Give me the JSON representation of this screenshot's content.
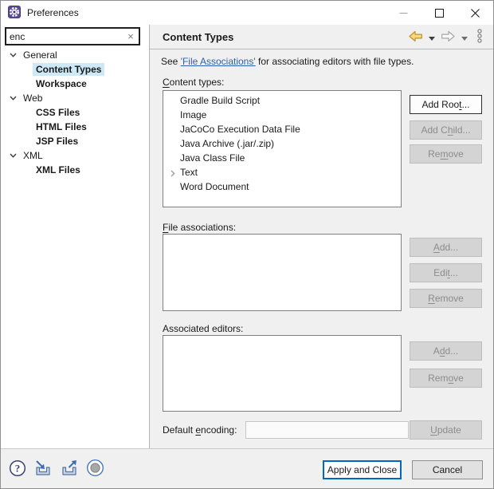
{
  "window": {
    "title": "Preferences"
  },
  "icons": {
    "app": "purple-gear",
    "minimize": "dash",
    "maximize": "square",
    "close": "x",
    "search_clear": "×",
    "tree_expanded": "chevron-down",
    "item_collapsed": "chevron-right",
    "nav_back": "yellow-back-arrow",
    "nav_back_menu": "caret-down",
    "nav_forward": "gray-forward-arrow",
    "nav_forward_menu": "caret-down",
    "view_menu": "three-circles",
    "help": "question-circle",
    "import": "arrow-into-tray",
    "export": "arrow-out-of-tray",
    "record": "gray-dot-circle"
  },
  "sidebar": {
    "search": {
      "value": "enc"
    },
    "tree": [
      {
        "label": "General",
        "type": "group",
        "expanded": true
      },
      {
        "label": "Content Types",
        "type": "child",
        "selected": true
      },
      {
        "label": "Workspace",
        "type": "child"
      },
      {
        "label": "Web",
        "type": "group",
        "expanded": true
      },
      {
        "label": "CSS Files",
        "type": "child"
      },
      {
        "label": "HTML Files",
        "type": "child"
      },
      {
        "label": "JSP Files",
        "type": "child"
      },
      {
        "label": "XML",
        "type": "group",
        "expanded": true
      },
      {
        "label": "XML Files",
        "type": "child"
      }
    ]
  },
  "header": {
    "title": "Content Types"
  },
  "content": {
    "intro": {
      "pre": "See ",
      "link": "'File Associations'",
      "post": " for associating editors with file types."
    },
    "content_types": {
      "label": {
        "pre": "",
        "mnemonic": "C",
        "post": "ontent types:"
      },
      "items": [
        "Gradle Build Script",
        "Image",
        "JaCoCo Execution Data File",
        "Java Archive (.jar/.zip)",
        "Java Class File",
        "Text",
        "Word Document"
      ],
      "collapsed_expandable_item": "Text",
      "buttons": {
        "add_root": {
          "pre": "Add Roo",
          "mnemonic": "t",
          "post": "...",
          "enabled": true
        },
        "add_child": {
          "pre": "Add C",
          "mnemonic": "h",
          "post": "ild...",
          "enabled": false
        },
        "remove": {
          "pre": "Re",
          "mnemonic": "m",
          "post": "ove",
          "enabled": false
        }
      }
    },
    "file_associations": {
      "label": {
        "pre": "",
        "mnemonic": "F",
        "post": "ile associations:"
      },
      "items": [],
      "buttons": {
        "add": {
          "pre": "",
          "mnemonic": "A",
          "post": "dd...",
          "enabled": false
        },
        "edit": {
          "pre": "Edi",
          "mnemonic": "t",
          "post": "...",
          "enabled": false
        },
        "remove": {
          "pre": "",
          "mnemonic": "R",
          "post": "emove",
          "enabled": false
        }
      }
    },
    "associated_editors": {
      "label": "Associated editors:",
      "items": [],
      "buttons": {
        "add": {
          "pre": "A",
          "mnemonic": "d",
          "post": "d...",
          "enabled": false
        },
        "remove": {
          "pre": "Rem",
          "mnemonic": "o",
          "post": "ve",
          "enabled": false
        }
      }
    },
    "default_encoding": {
      "label": {
        "pre": "Default ",
        "mnemonic": "e",
        "post": "ncoding:"
      },
      "value": "",
      "update_button": {
        "pre": "",
        "mnemonic": "U",
        "post": "pdate",
        "enabled": false
      }
    }
  },
  "footer": {
    "apply_label": "Apply and Close",
    "cancel_label": "Cancel"
  }
}
